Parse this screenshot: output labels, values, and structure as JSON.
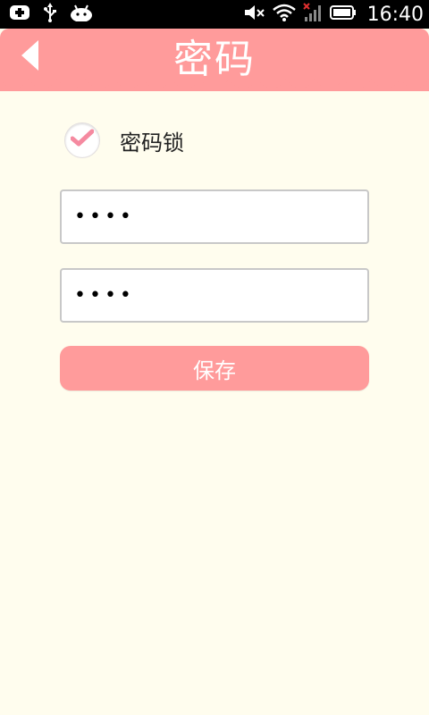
{
  "status_bar": {
    "time": "16:40",
    "icons": [
      "usb-debug-icon",
      "usb-icon",
      "android-icon",
      "mute-icon",
      "wifi-icon",
      "signal-off-icon",
      "battery-icon"
    ]
  },
  "header": {
    "title": "密码",
    "color": "#ff9b9b",
    "back_icon": "back-arrow-icon"
  },
  "password_lock": {
    "label": "密码锁",
    "checked": true
  },
  "fields": [
    {
      "value": "••••"
    },
    {
      "value": "••••"
    }
  ],
  "save_button": {
    "label": "保存"
  },
  "colors": {
    "accent": "#ff9b9b",
    "background": "#fffdee"
  }
}
